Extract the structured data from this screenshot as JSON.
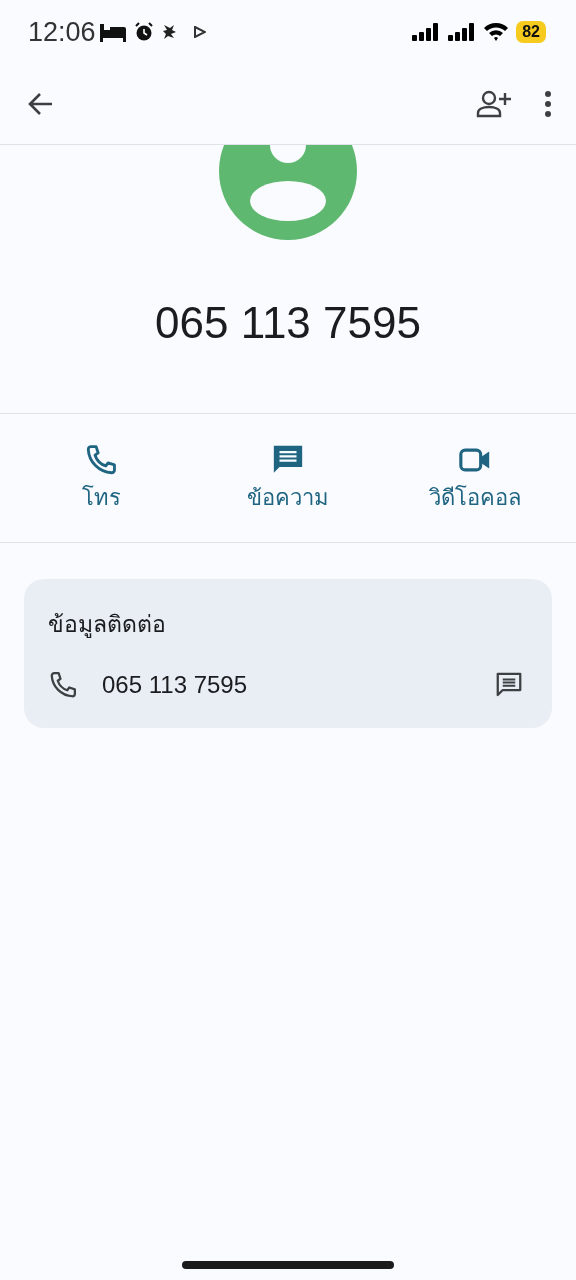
{
  "status_bar": {
    "time": "12:06",
    "battery": "82"
  },
  "contact": {
    "number": "065 113 7595"
  },
  "actions": [
    {
      "kind": "call",
      "label": "โทร"
    },
    {
      "kind": "message",
      "label": "ข้อความ"
    },
    {
      "kind": "video",
      "label": "วิดีโอคอล"
    }
  ],
  "contact_info": {
    "title": "ข้อมูลติดต่อ",
    "phone": "065 113 7595"
  }
}
